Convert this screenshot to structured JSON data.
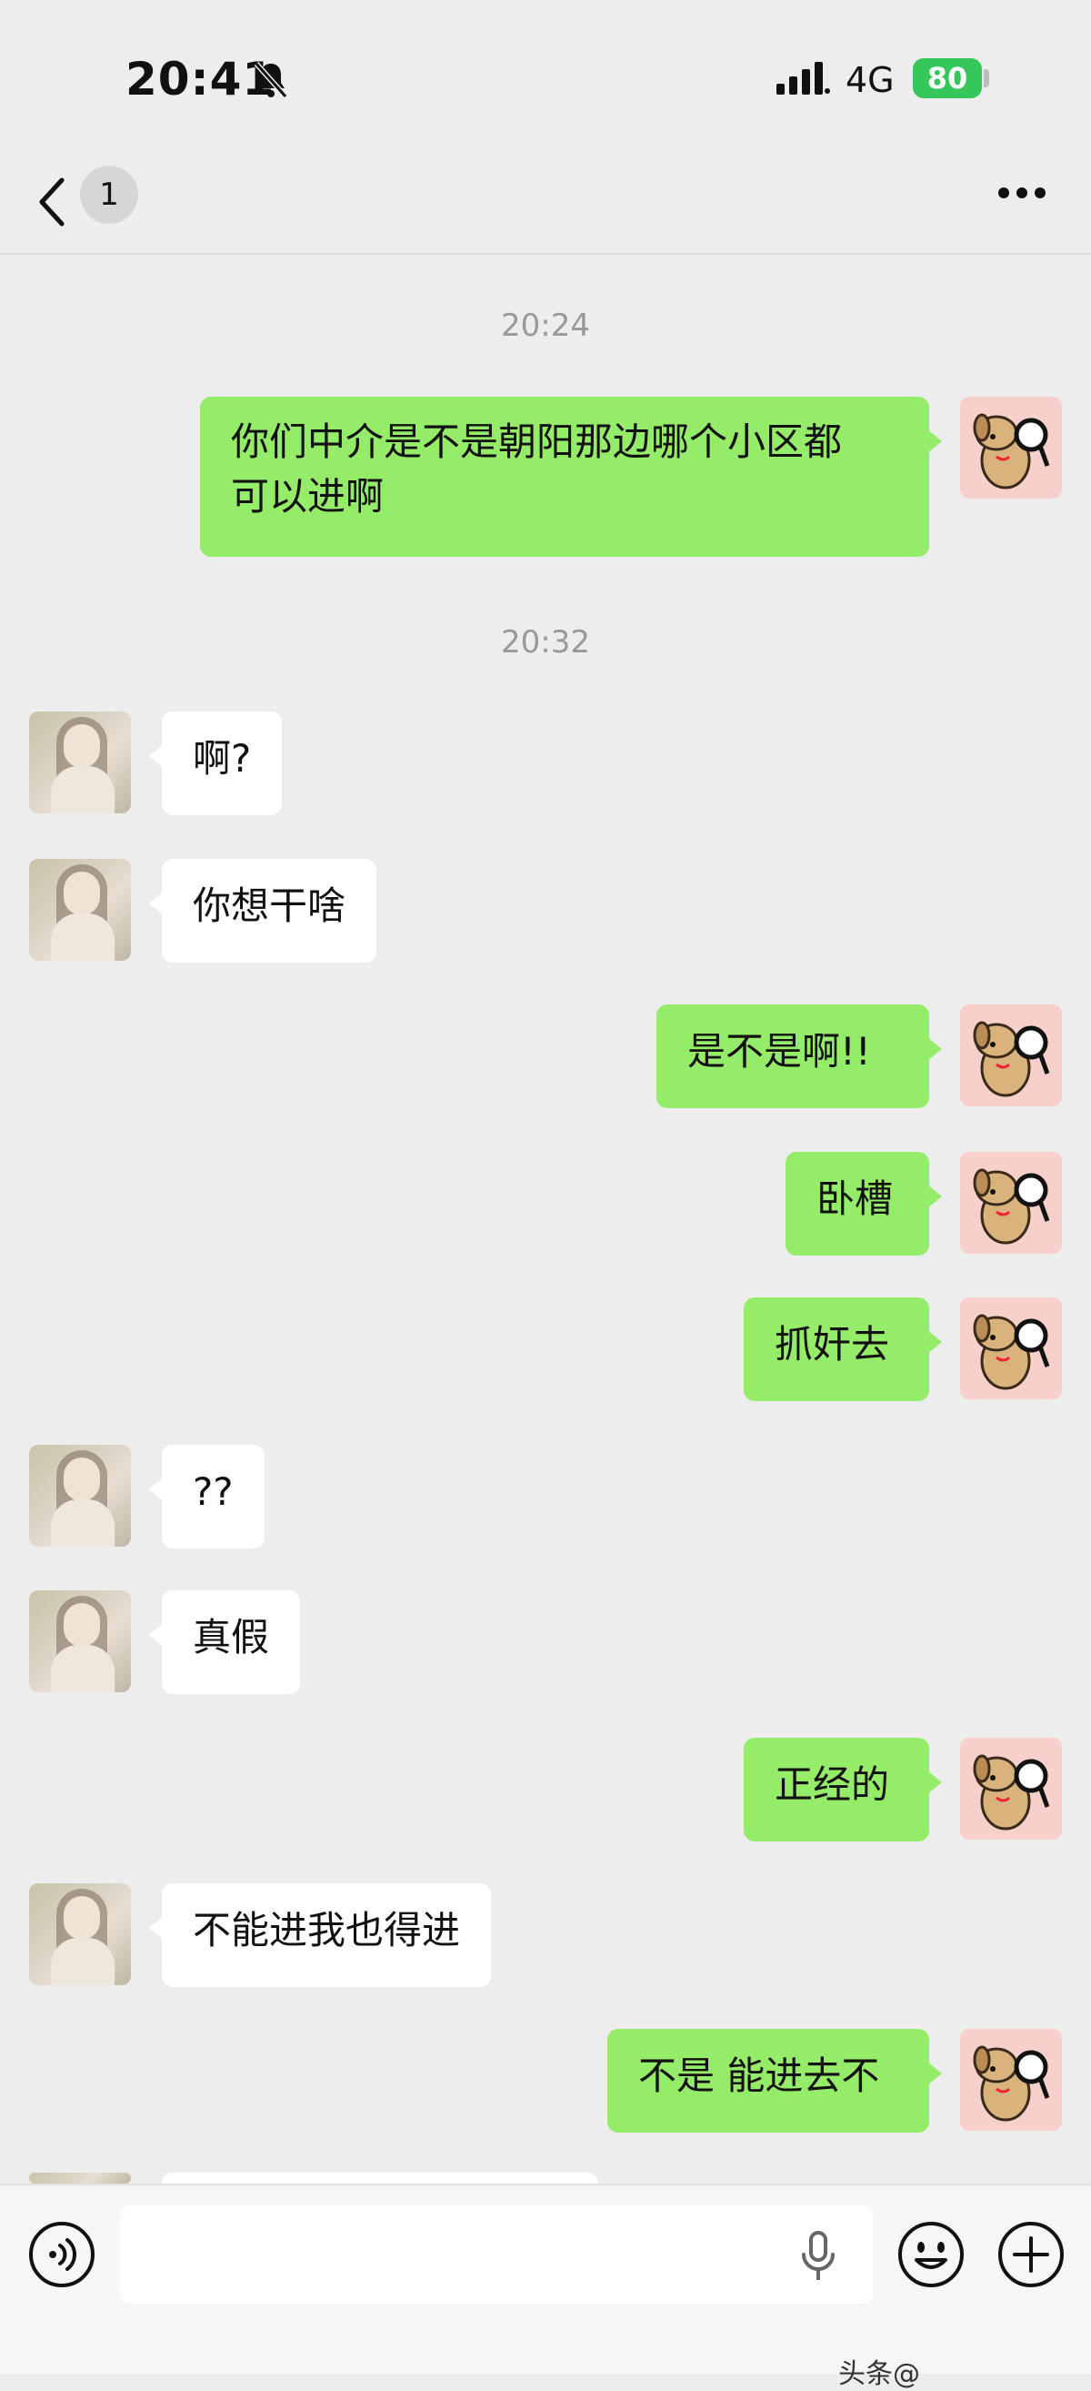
{
  "status_bar": {
    "time": "20:41",
    "network": "4G",
    "battery": "80"
  },
  "nav": {
    "back_label": "",
    "unread_count": "1"
  },
  "colors": {
    "sent_bubble": "#95ec69",
    "received_bubble": "#ffffff",
    "background": "#ededed"
  },
  "messages": [
    {
      "type": "timestamp",
      "text": "20:24"
    },
    {
      "type": "sent",
      "text": "你们中介是不是朝阳那边哪个小区都可以进啊",
      "line1": "你们中介是不是朝阳那边哪个小区都",
      "line2": "可以进啊"
    },
    {
      "type": "timestamp",
      "text": "20:32"
    },
    {
      "type": "received",
      "text": "啊?"
    },
    {
      "type": "received",
      "text": "你想干啥"
    },
    {
      "type": "sent",
      "text": "是不是啊!!"
    },
    {
      "type": "sent",
      "text": "卧槽"
    },
    {
      "type": "sent",
      "text": "抓奸去"
    },
    {
      "type": "received",
      "text": "??"
    },
    {
      "type": "received",
      "text": "真假"
    },
    {
      "type": "sent",
      "text": "正经的"
    },
    {
      "type": "received",
      "text": "不能进我也得进"
    },
    {
      "type": "sent",
      "text": "不是 能进去不"
    }
  ],
  "input": {
    "voice_icon": "voice-mode-icon",
    "mic_icon": "microphone-icon",
    "emoji_icon": "emoji-icon",
    "plus_icon": "plus-icon"
  },
  "watermark": "头条@"
}
